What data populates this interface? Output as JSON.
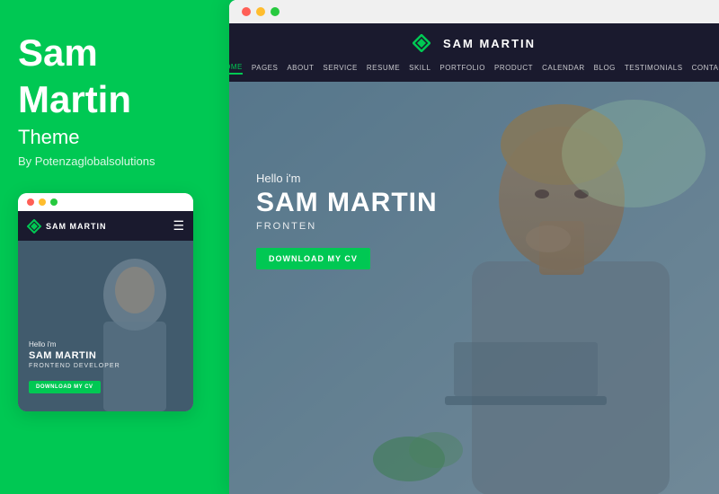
{
  "left": {
    "title_line1": "Sam",
    "title_line2": "Martin",
    "subtitle": "Theme",
    "by": "By Potenzaglobalsolutions",
    "mobile_preview": {
      "dots": [
        "red",
        "yellow",
        "green"
      ],
      "brand": "SAM MARTIN",
      "hero": {
        "hello": "Hello i'm",
        "name": "SAM MARTIN",
        "role": "FRONTEND DEVELOPER",
        "btn": "DOWNLOAD MY CV"
      }
    }
  },
  "desktop": {
    "dots": [
      "red",
      "yellow",
      "green"
    ],
    "nav": {
      "brand": "SAM MARTIN",
      "links": [
        "HOME",
        "PAGES",
        "ABOUT",
        "SERVICE",
        "RESUME",
        "SKILL",
        "PORTFOLIO",
        "PRODUCT",
        "CALENDAR",
        "BLOG",
        "TESTIMONIALS",
        "CONTACT"
      ]
    },
    "hero": {
      "hello": "Hello i'm",
      "name": "SAM MARTIN",
      "role": "FRONTEN",
      "btn": "DOWNLOAD MY CV"
    }
  },
  "colors": {
    "green": "#00c853",
    "dark_nav": "#1a1a2e",
    "white": "#ffffff"
  }
}
